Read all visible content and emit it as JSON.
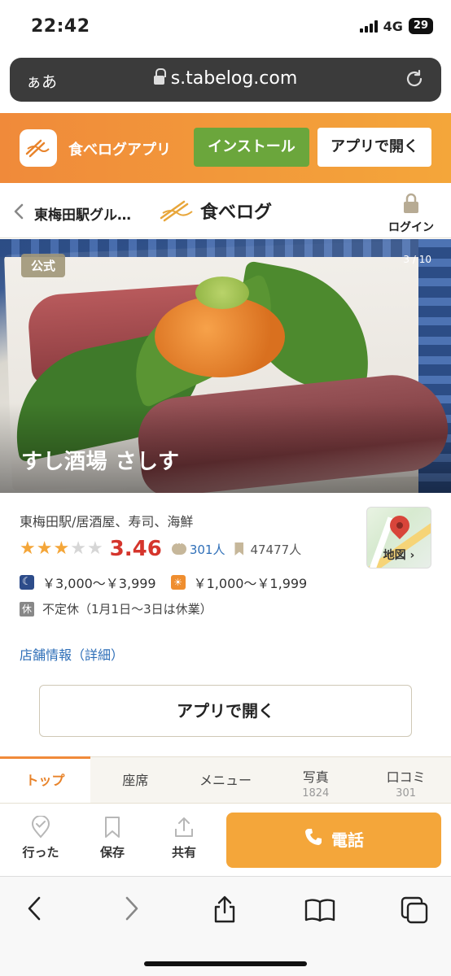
{
  "status": {
    "time": "22:42",
    "network": "4G",
    "battery": "29"
  },
  "browser": {
    "text_size": "ぁあ",
    "url": "s.tabelog.com"
  },
  "app_banner": {
    "app_name": "食べログアプリ",
    "install_label": "インストール",
    "open_label": "アプリで開く"
  },
  "header": {
    "breadcrumb": "東梅田駅グル…",
    "logo_text": "食べログ",
    "login_label": "ログイン"
  },
  "hero": {
    "badge": "公式",
    "counter": "3 / 10",
    "title": "すし酒場 さしす"
  },
  "restaurant": {
    "genre": "東梅田駅/居酒屋、寿司、海鮮",
    "stars": 3,
    "stars_max": 5,
    "score": "3.46",
    "reviews": "301人",
    "saves": "47477人",
    "dinner_price": "￥3,000～￥3,999",
    "lunch_price": "￥1,000～￥1,999",
    "holiday_tag": "休",
    "holiday": "不定休（1月1日～3日は休業）",
    "details_link": "店舗情報（詳細）",
    "map_label": "地図 ›",
    "open_app_label": "アプリで開く"
  },
  "tabs": [
    {
      "label": "トップ",
      "count": ""
    },
    {
      "label": "座席",
      "count": ""
    },
    {
      "label": "メニュー",
      "count": ""
    },
    {
      "label": "写真",
      "count": "1824"
    },
    {
      "label": "口コミ",
      "count": "301"
    }
  ],
  "actions": {
    "visited": "行った",
    "save": "保存",
    "share": "共有",
    "call": "電話"
  },
  "colors": {
    "accent_orange": "#f08a3a",
    "install_green": "#6ba63c",
    "score_red": "#d5352c",
    "link_blue": "#2f6fb8"
  }
}
